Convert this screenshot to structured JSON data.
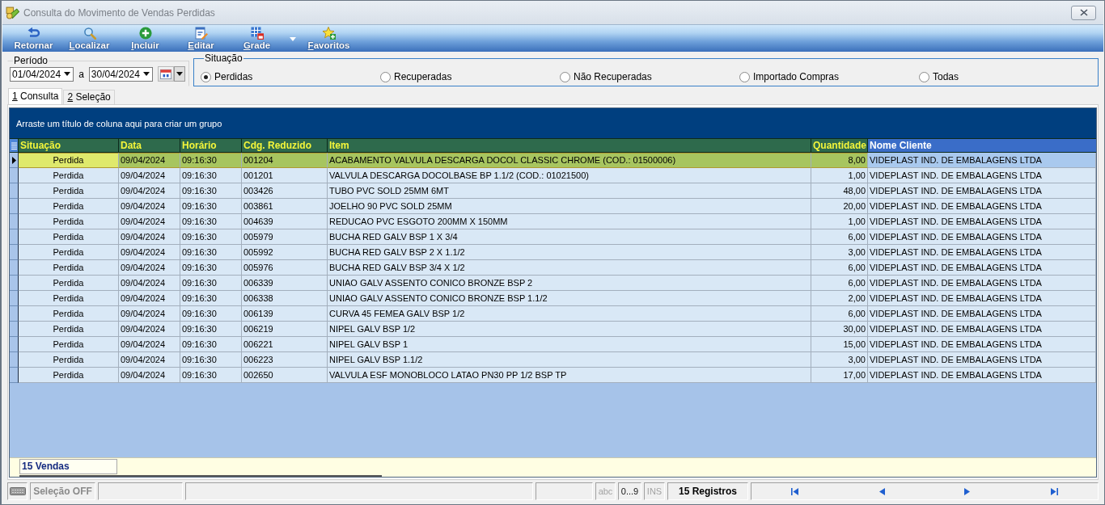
{
  "window": {
    "title": "Consulta do Movimento de Vendas Perdidas"
  },
  "toolbar": [
    {
      "label": "Retornar",
      "mnemonic": false
    },
    {
      "label": "Localizar",
      "mnemonic": true
    },
    {
      "label": "Incluir",
      "mnemonic": true
    },
    {
      "label": "Editar",
      "mnemonic": true
    },
    {
      "label": "Grade",
      "mnemonic": true
    },
    {
      "label": "Favoritos",
      "mnemonic": true
    }
  ],
  "periodo": {
    "label": "Período",
    "from": "01/04/2024",
    "separator": "a",
    "to": "30/04/2024"
  },
  "situacao": {
    "label": "Situação",
    "options": [
      {
        "label": "Perdidas",
        "selected": true
      },
      {
        "label": "Recuperadas",
        "selected": false
      },
      {
        "label": "Não Recuperadas",
        "selected": false
      },
      {
        "label": "Importado Compras",
        "selected": false
      },
      {
        "label": "Todas",
        "selected": false
      }
    ]
  },
  "tabs": [
    {
      "label": "1 Consulta",
      "mnemonic": true,
      "selected": true
    },
    {
      "label": "2 Seleção",
      "mnemonic": true,
      "selected": false
    }
  ],
  "grid": {
    "group_hint": "Arraste um título de coluna aqui para criar um grupo",
    "columns": [
      {
        "label": "Situação",
        "kind": "status",
        "focused": true,
        "highlighted": false
      },
      {
        "label": "Data",
        "kind": "date",
        "focused": false,
        "highlighted": false
      },
      {
        "label": "Horário",
        "kind": "time",
        "focused": false,
        "highlighted": false
      },
      {
        "label": "Cdg. Reduzido",
        "kind": "code",
        "focused": false,
        "highlighted": false
      },
      {
        "label": "Item",
        "kind": "text",
        "focused": false,
        "highlighted": false
      },
      {
        "label": "Quantidade",
        "kind": "number",
        "focused": false,
        "highlighted": false
      },
      {
        "label": "Nome Cliente",
        "kind": "text",
        "focused": false,
        "highlighted": true
      }
    ],
    "rows": [
      {
        "selected": true,
        "cells": [
          "Perdida",
          "09/04/2024",
          "09:16:30",
          "001204",
          "ACABAMENTO VALVULA DESCARGA DOCOL CLASSIC CHROME (COD.: 01500006)",
          "8,00",
          "VIDEPLAST IND. DE EMBALAGENS LTDA"
        ]
      },
      {
        "selected": false,
        "cells": [
          "Perdida",
          "09/04/2024",
          "09:16:30",
          "001201",
          "VALVULA DESCARGA DOCOLBASE BP 1.1/2 (COD.: 01021500)",
          "1,00",
          "VIDEPLAST IND. DE EMBALAGENS LTDA"
        ]
      },
      {
        "selected": false,
        "cells": [
          "Perdida",
          "09/04/2024",
          "09:16:30",
          "003426",
          "TUBO PVC SOLD 25MM 6MT",
          "48,00",
          "VIDEPLAST IND. DE EMBALAGENS LTDA"
        ]
      },
      {
        "selected": false,
        "cells": [
          "Perdida",
          "09/04/2024",
          "09:16:30",
          "003861",
          "JOELHO 90 PVC SOLD 25MM",
          "20,00",
          "VIDEPLAST IND. DE EMBALAGENS LTDA"
        ]
      },
      {
        "selected": false,
        "cells": [
          "Perdida",
          "09/04/2024",
          "09:16:30",
          "004639",
          "REDUCAO PVC ESGOTO 200MM X 150MM",
          "1,00",
          "VIDEPLAST IND. DE EMBALAGENS LTDA"
        ]
      },
      {
        "selected": false,
        "cells": [
          "Perdida",
          "09/04/2024",
          "09:16:30",
          "005979",
          "BUCHA RED GALV BSP 1 X 3/4",
          "6,00",
          "VIDEPLAST IND. DE EMBALAGENS LTDA"
        ]
      },
      {
        "selected": false,
        "cells": [
          "Perdida",
          "09/04/2024",
          "09:16:30",
          "005992",
          "BUCHA RED GALV BSP 2 X 1.1/2",
          "3,00",
          "VIDEPLAST IND. DE EMBALAGENS LTDA"
        ]
      },
      {
        "selected": false,
        "cells": [
          "Perdida",
          "09/04/2024",
          "09:16:30",
          "005976",
          "BUCHA RED GALV BSP 3/4 X 1/2",
          "6,00",
          "VIDEPLAST IND. DE EMBALAGENS LTDA"
        ]
      },
      {
        "selected": false,
        "cells": [
          "Perdida",
          "09/04/2024",
          "09:16:30",
          "006339",
          "UNIAO GALV ASSENTO CONICO BRONZE BSP 2",
          "6,00",
          "VIDEPLAST IND. DE EMBALAGENS LTDA"
        ]
      },
      {
        "selected": false,
        "cells": [
          "Perdida",
          "09/04/2024",
          "09:16:30",
          "006338",
          "UNIAO GALV ASSENTO CONICO BRONZE BSP 1.1/2",
          "2,00",
          "VIDEPLAST IND. DE EMBALAGENS LTDA"
        ]
      },
      {
        "selected": false,
        "cells": [
          "Perdida",
          "09/04/2024",
          "09:16:30",
          "006139",
          "CURVA 45 FEMEA GALV BSP 1/2",
          "6,00",
          "VIDEPLAST IND. DE EMBALAGENS LTDA"
        ]
      },
      {
        "selected": false,
        "cells": [
          "Perdida",
          "09/04/2024",
          "09:16:30",
          "006219",
          "NIPEL GALV BSP 1/2",
          "30,00",
          "VIDEPLAST IND. DE EMBALAGENS LTDA"
        ]
      },
      {
        "selected": false,
        "cells": [
          "Perdida",
          "09/04/2024",
          "09:16:30",
          "006221",
          "NIPEL GALV BSP 1",
          "15,00",
          "VIDEPLAST IND. DE EMBALAGENS LTDA"
        ]
      },
      {
        "selected": false,
        "cells": [
          "Perdida",
          "09/04/2024",
          "09:16:30",
          "006223",
          "NIPEL GALV BSP 1.1/2",
          "3,00",
          "VIDEPLAST IND. DE EMBALAGENS LTDA"
        ]
      },
      {
        "selected": false,
        "cells": [
          "Perdida",
          "09/04/2024",
          "09:16:30",
          "002650",
          "VALVULA ESF MONOBLOCO LATAO PN30 PP 1/2 BSP TP",
          "17,00",
          "VIDEPLAST IND. DE EMBALAGENS LTDA"
        ]
      }
    ],
    "footer": "15 Vendas"
  },
  "status_bar": {
    "selection": "Seleção OFF",
    "indicators": [
      {
        "label": "abc",
        "on": false
      },
      {
        "label": "0...9",
        "on": true
      },
      {
        "label": "INS",
        "on": false
      }
    ],
    "records": "15 Registros"
  }
}
